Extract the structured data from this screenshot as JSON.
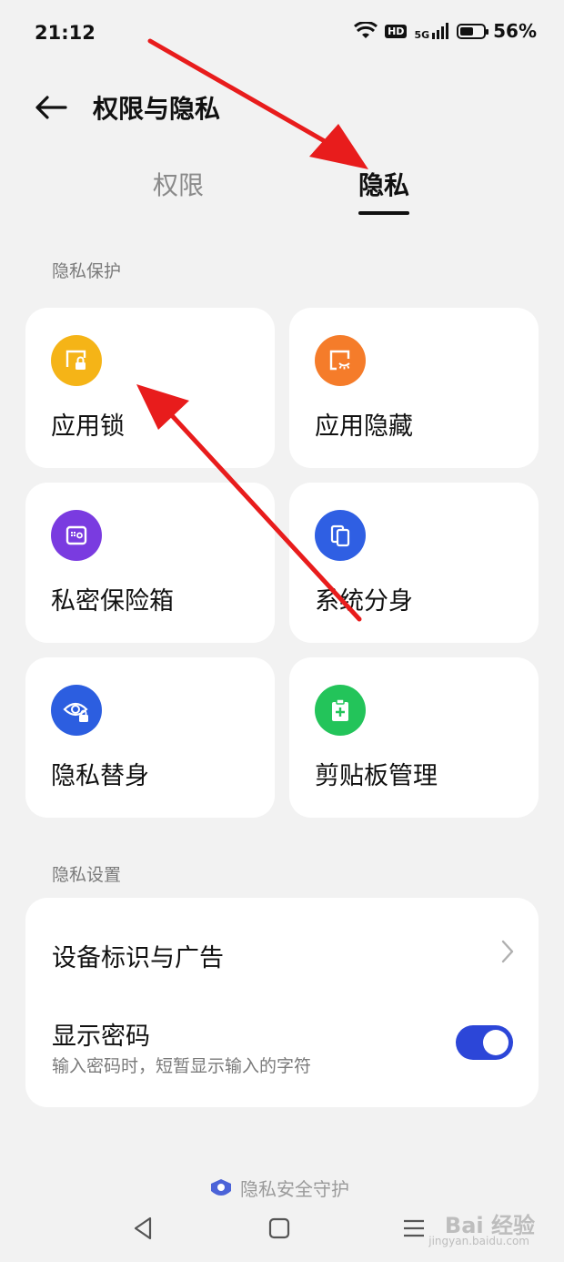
{
  "status_bar": {
    "time": "21:12",
    "hd_label": "HD",
    "network_label": "5G",
    "battery_percent": "56%",
    "battery_level": 0.56,
    "icons": [
      "wifi-icon",
      "hd-icon",
      "signal-icon",
      "battery-icon"
    ]
  },
  "header": {
    "back_icon": "arrow-left-icon",
    "title": "权限与隐私"
  },
  "tabs": [
    {
      "label": "权限",
      "active": false
    },
    {
      "label": "隐私",
      "active": true
    }
  ],
  "privacy_protection": {
    "section_label": "隐私保护",
    "items": [
      {
        "label": "应用锁",
        "icon": "app-lock-icon",
        "color": "#f5b417"
      },
      {
        "label": "应用隐藏",
        "icon": "app-hide-icon",
        "color": "#f57c2a"
      },
      {
        "label": "私密保险箱",
        "icon": "safe-box-icon",
        "color": "#7a3be0"
      },
      {
        "label": "系统分身",
        "icon": "system-clone-icon",
        "color": "#2f5fe3"
      },
      {
        "label": "隐私替身",
        "icon": "privacy-substitute-icon",
        "color": "#2c5ee0"
      },
      {
        "label": "剪贴板管理",
        "icon": "clipboard-icon",
        "color": "#23c45a"
      }
    ]
  },
  "privacy_settings": {
    "section_label": "隐私设置",
    "rows": [
      {
        "title": "设备标识与广告",
        "control": "chevron-right-icon"
      },
      {
        "title": "显示密码",
        "subtitle": "输入密码时，短暂显示输入的字符",
        "toggle_on": true
      }
    ]
  },
  "footer": {
    "link_text": "隐私安全守护",
    "nav_icons": [
      "back-triangle-icon",
      "home-square-icon",
      "menu-lines-icon"
    ],
    "watermark": "Bai 经验",
    "watermark_sub": "jingyan.baidu.com"
  },
  "colors": {
    "background": "#f2f2f2",
    "card": "#ffffff",
    "accent": "#2c46d8",
    "annotation": "#e81c1c"
  }
}
